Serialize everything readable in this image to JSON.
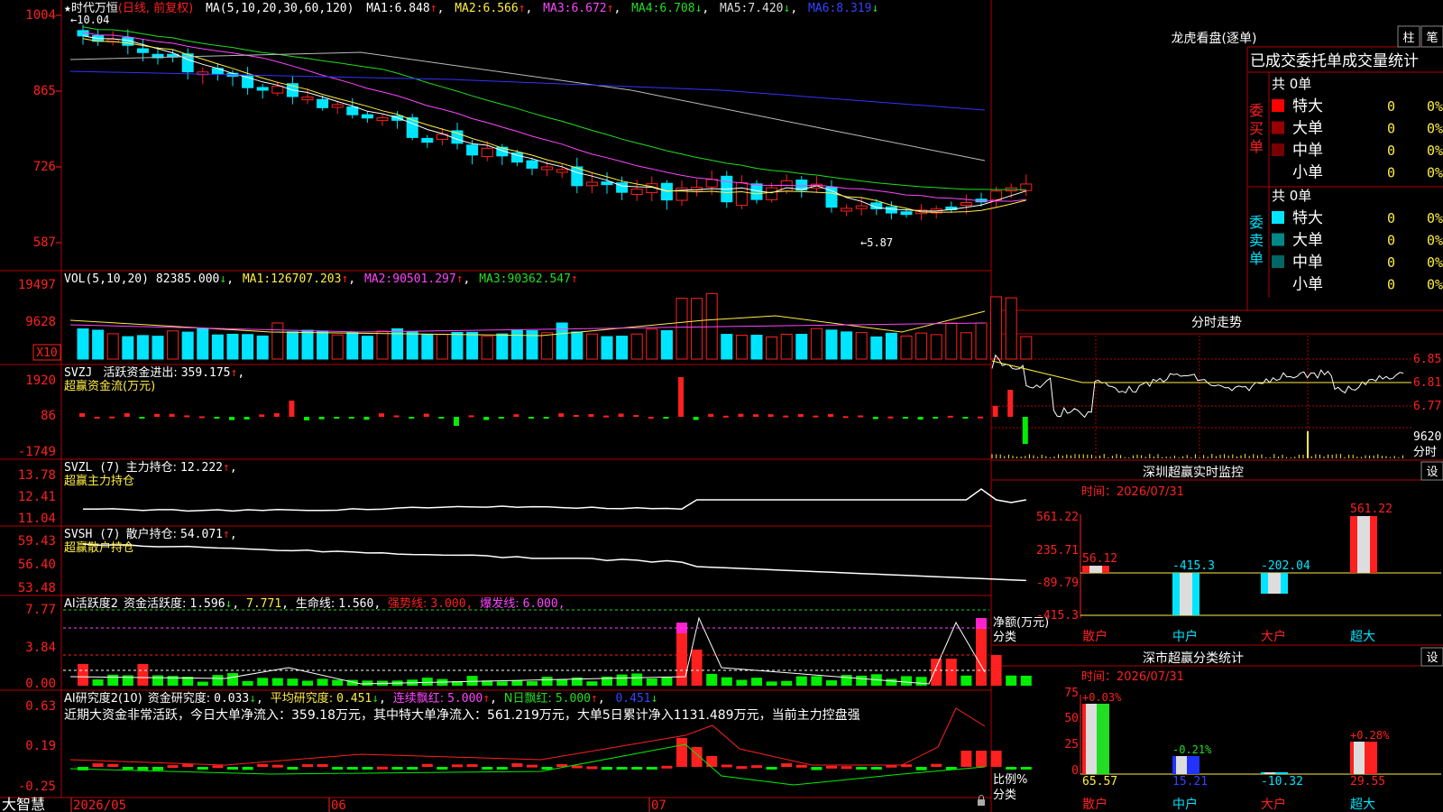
{
  "colors": {
    "up": "#ff2020",
    "down": "#00e5ff",
    "green": "#00ee00",
    "red": "#ff2020",
    "white": "#ffffff",
    "yellow": "#ffee44",
    "magenta": "#ff44ff",
    "ma4": "#22dd22",
    "ma5": "#bbbbbb",
    "ma6": "#3333ff",
    "grid": "#b00000"
  },
  "price_panel": {
    "star": "★",
    "name": "时代万恒",
    "mode": "(日线, 前复权)",
    "ma_header": "MA(5,10,20,30,60,120)",
    "ma": [
      {
        "label": "MA1:",
        "value": "6.848",
        "arrow": "↑"
      },
      {
        "label": "MA2:",
        "value": "6.566",
        "arrow": "↑"
      },
      {
        "label": "MA3:",
        "value": "6.672",
        "arrow": "↑"
      },
      {
        "label": "MA4:",
        "value": "6.708",
        "arrow": "↓"
      },
      {
        "label": "MA5:",
        "value": "7.420",
        "arrow": "↓"
      },
      {
        "label": "MA6:",
        "value": "8.319",
        "arrow": "↓"
      }
    ],
    "axis": [
      "1004",
      "865",
      "726",
      "587"
    ],
    "high_note": "←10.04",
    "low_note": "←5.87"
  },
  "vol_panel": {
    "header": "VOL(5,10,20)",
    "value": "82385.000",
    "arrow": "↓",
    "ma": [
      {
        "label": "MA1:",
        "value": "126707.203",
        "arrow": "↑"
      },
      {
        "label": "MA2:",
        "value": "90501.297",
        "arrow": "↑"
      },
      {
        "label": "MA3:",
        "value": "90362.547",
        "arrow": "↑"
      }
    ],
    "axis": [
      "19497",
      "9628"
    ],
    "unit": "X10"
  },
  "svzj_panel": {
    "header": "SVZJ",
    "title": "活跃资金进出:",
    "value": "359.175",
    "arrow": "↑",
    "sub": "超赢资金流(万元)",
    "axis": [
      "1920",
      "86",
      "-1749"
    ]
  },
  "svzl_panel": {
    "header": "SVZL (7)",
    "title": "主力持仓:",
    "value": "12.222",
    "arrow": "↑",
    "sub": "超赢主力持仓",
    "axis": [
      "13.78",
      "12.41",
      "11.04"
    ]
  },
  "svsh_panel": {
    "header": "SVSH (7)",
    "title": "散户持仓:",
    "value": "54.071",
    "arrow": "↑",
    "sub": "超赢散户持仓",
    "axis": [
      "59.43",
      "56.40",
      "53.48"
    ]
  },
  "ai1_panel": {
    "header": "AI活跃度2",
    "t1": "资金活跃度:",
    "v1": "1.596",
    "a1": "↓",
    "v2": "7.771",
    "t3": "生命线:",
    "v3": "1.560",
    "t4": "强势线:",
    "v4": "3.000",
    "t5": "爆发线:",
    "v5": "6.000",
    "axis": [
      "7.77",
      "3.84",
      "0.00"
    ]
  },
  "ai2_panel": {
    "header": "AI研究度2(10)",
    "t1": "资金研究度:",
    "v1": "0.033",
    "a1": "↓",
    "t2": "平均研究度:",
    "v2": "0.451",
    "a2": "↓",
    "t3": "连续飘红:",
    "v3": "5.000",
    "a3": "↑",
    "t4": "N日飘红:",
    "v4": "5.000",
    "a4": "↑",
    "v5": "0.451",
    "a5": "↓",
    "comment": "近期大资金非常活跃，今日大单净流入：359.18万元，其中特大单净流入：561.219万元，大单5日累计净入1131.489万元，当前主力控盘强",
    "axis": [
      "0.63",
      "0.19",
      "-0.25"
    ]
  },
  "bottom_bar": {
    "logo": "大智慧",
    "dates": [
      "2026/05",
      "06",
      "07"
    ]
  },
  "right": {
    "lhb_title": "龙虎看盘(逐单)",
    "btn1": "柱",
    "btn2": "笔",
    "section_title": "已成交委托单成交量统计",
    "buy": {
      "label": "委买单",
      "total": "共 0单",
      "rows": [
        {
          "name": "特大",
          "v": "0",
          "p": "0%",
          "color": "#ff0000"
        },
        {
          "name": "大单",
          "v": "0",
          "p": "0%",
          "color": "#990000"
        },
        {
          "name": "中单",
          "v": "0",
          "p": "0%",
          "color": "#770000"
        },
        {
          "name": "小单",
          "v": "0",
          "p": "0%",
          "color": ""
        }
      ]
    },
    "sell": {
      "label": "委卖单",
      "total": "共 0单",
      "rows": [
        {
          "name": "特大",
          "v": "0",
          "p": "0%",
          "color": "#00e5ff"
        },
        {
          "name": "大单",
          "v": "0",
          "p": "0%",
          "color": "#008888"
        },
        {
          "name": "中单",
          "v": "0",
          "p": "0%",
          "color": "#006666"
        },
        {
          "name": "小单",
          "v": "0",
          "p": "0%",
          "color": ""
        }
      ]
    },
    "fenshi": {
      "title": "分时走势",
      "axis": [
        "6.85",
        "6.81",
        "6.77"
      ],
      "vol": "9620",
      "vol_label": "分时"
    },
    "sz_monitor": {
      "title": "深圳超赢实时监控",
      "btn": "设",
      "time": "时间：2026/07/31",
      "axis": [
        "561.22",
        "235.71",
        "-89.79",
        "-415.3"
      ],
      "ylabel": "净额(万元)",
      "xlabel": "分类",
      "bars": [
        {
          "cat": "散户",
          "v": "56.12"
        },
        {
          "cat": "中户",
          "v": "-415.3"
        },
        {
          "cat": "大户",
          "v": "-202.04"
        },
        {
          "cat": "超大",
          "v": "561.22"
        }
      ]
    },
    "sz_class": {
      "title": "深市超赢分类统计",
      "btn": "设",
      "time": "时间：2026/07/31",
      "axis": [
        "75",
        "50",
        "25",
        "0"
      ],
      "ylabel": "比例%",
      "xlabel": "分类",
      "bars": [
        {
          "cat": "散户",
          "top": "+0.03%",
          "bottom": "65.57"
        },
        {
          "cat": "中户",
          "top": "-0.21%",
          "bottom": "15.21"
        },
        {
          "cat": "大户",
          "top": "",
          "bottom": "-10.32"
        },
        {
          "cat": "超大",
          "top": "+0.28%",
          "bottom": "29.55"
        }
      ]
    }
  }
}
